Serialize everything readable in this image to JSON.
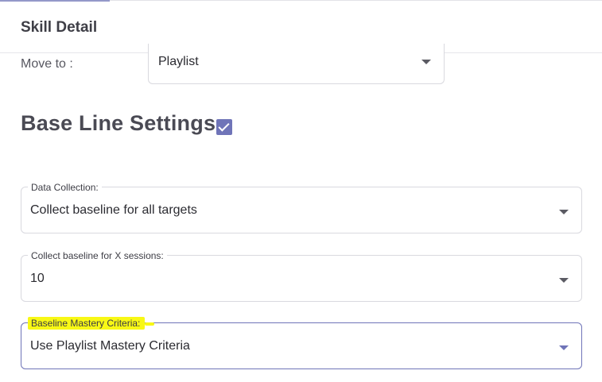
{
  "header": {
    "title": "Skill Detail"
  },
  "move": {
    "label": "Move to :",
    "value": "Playlist"
  },
  "baseline": {
    "title": "Base Line Settings",
    "checked": true
  },
  "fields": [
    {
      "label": "Data Collection:",
      "value": "Collect baseline for all targets"
    },
    {
      "label": "Collect baseline for X sessions:",
      "value": "10"
    },
    {
      "label": "Baseline Mastery Criteria:",
      "value": "Use Playlist Mastery Criteria"
    }
  ],
  "colors": {
    "accent": "#6f74b8",
    "highlight": "#f8f815"
  },
  "icons": {
    "dropdown": "chevron-down-icon",
    "checkbox": "checkbox-checked-icon"
  }
}
